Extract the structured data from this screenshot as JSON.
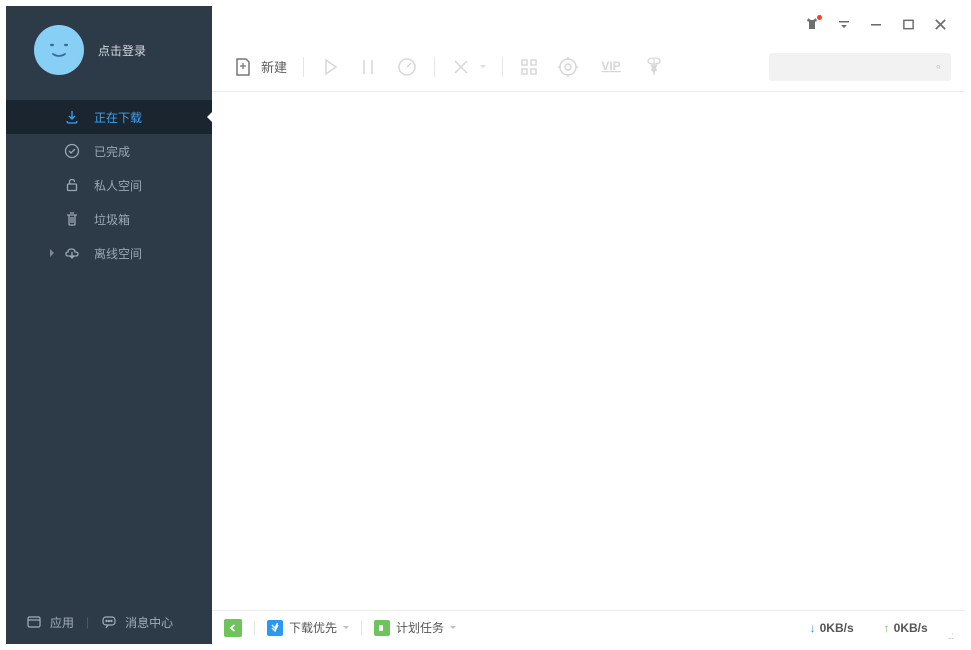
{
  "sidebar": {
    "login_label": "点击登录",
    "nav": [
      {
        "label": "正在下载",
        "icon": "download"
      },
      {
        "label": "已完成",
        "icon": "check"
      },
      {
        "label": "私人空间",
        "icon": "lock"
      },
      {
        "label": "垃圾箱",
        "icon": "trash"
      },
      {
        "label": "离线空间",
        "icon": "cloud"
      }
    ],
    "footer": {
      "apps_label": "应用",
      "messages_label": "消息中心"
    }
  },
  "toolbar": {
    "new_label": "新建"
  },
  "search": {
    "placeholder": ""
  },
  "statusbar": {
    "priority_label": "下载优先",
    "schedule_label": "计划任务",
    "download_speed": "0KB/s",
    "upload_speed": "0KB/s"
  }
}
